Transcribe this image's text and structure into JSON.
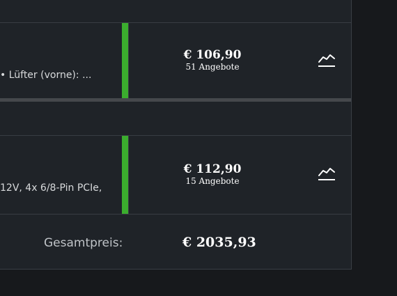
{
  "products": [
    {
      "description": "• Lüfter (vorne): ...",
      "price": "€ 106,90",
      "offers": "51 Angebote",
      "chart_icon": "price-trend-chart-icon",
      "availability_color": "#3bad2e"
    },
    {
      "description": "12V, 4x 6/8-Pin PCIe,",
      "price": "€ 112,90",
      "offers": "15 Angebote",
      "chart_icon": "price-trend-chart-icon",
      "availability_color": "#3bad2e"
    }
  ],
  "total": {
    "label": "Gesamtpreis:",
    "value": "€ 2035,93"
  }
}
